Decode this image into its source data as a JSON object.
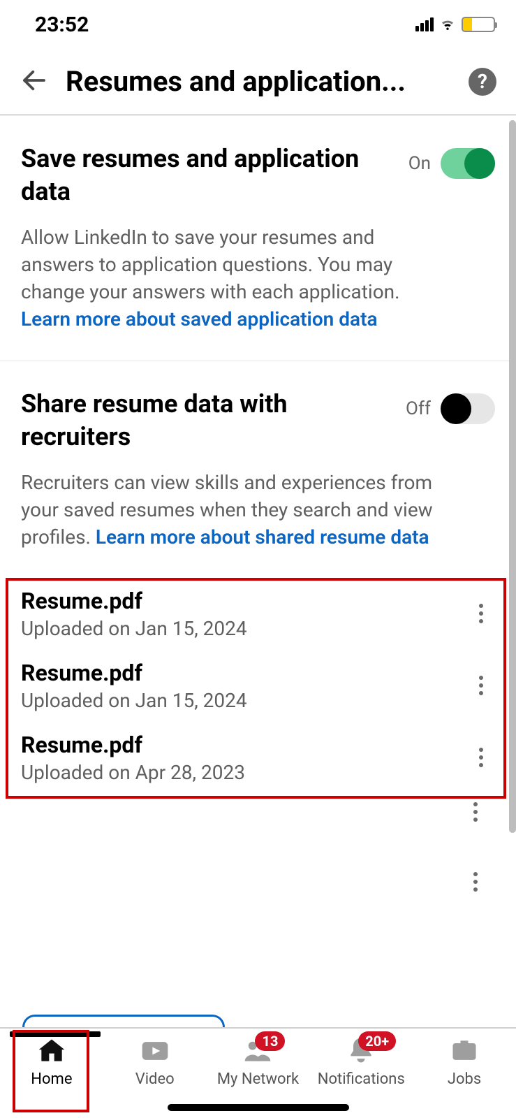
{
  "statusbar": {
    "time": "23:52"
  },
  "header": {
    "title": "Resumes and application..."
  },
  "sections": {
    "save": {
      "title": "Save resumes and application data",
      "toggle_state": "On",
      "desc_text": "Allow LinkedIn to save your resumes and answers to application questions. You may change your answers with each application. ",
      "learn_more": "Learn more about saved application data"
    },
    "share": {
      "title": "Share resume data with recruiters",
      "toggle_state": "Off",
      "desc_text": "Recruiters can view skills and experiences from your saved resumes when they search and view profiles. ",
      "learn_more": "Learn more about shared resume data"
    }
  },
  "resumes": [
    {
      "name": "Resume.pdf",
      "date": "Uploaded on Jan 15, 2024"
    },
    {
      "name": "Resume.pdf",
      "date": "Uploaded on Jan 15, 2024"
    },
    {
      "name": "Resume.pdf",
      "date": "Uploaded on Apr 28, 2023"
    }
  ],
  "nav": {
    "home": "Home",
    "video": "Video",
    "network": "My Network",
    "network_badge": "13",
    "notifications": "Notifications",
    "notifications_badge": "20+",
    "jobs": "Jobs"
  }
}
